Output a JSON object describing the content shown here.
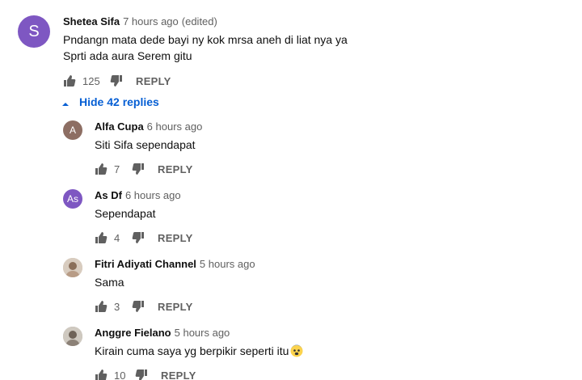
{
  "main_comment": {
    "avatar_letter": "S",
    "avatar_color": "#7e57c2",
    "author": "Shetea Sifa",
    "time": "7 hours ago",
    "edited": "(edited)",
    "text_line1": "Pndangn mata dede bayi ny kok mrsa aneh di liat nya ya",
    "text_line2": "Sprti ada aura Serem gitu",
    "likes": "125",
    "reply_label": "REPLY"
  },
  "hide_replies": {
    "label": "Hide 42 replies",
    "icon": "caret-up-icon"
  },
  "replies": [
    {
      "avatar_letter": "A",
      "avatar_color": "#8d6e63",
      "author": "Alfa Cupa",
      "time": "6 hours ago",
      "text": "Siti Sifa sependapat",
      "likes": "7",
      "reply_label": "REPLY"
    },
    {
      "avatar_letter": "As",
      "avatar_color": "#7e57c2",
      "author": "As Df",
      "time": "6 hours ago",
      "text": "Sependapat",
      "likes": "4",
      "reply_label": "REPLY"
    },
    {
      "avatar_letter": "",
      "avatar_color": "#c9b8a6",
      "author": "Fitri Adiyati Channel",
      "time": "5 hours ago",
      "text": "Sama",
      "likes": "3",
      "reply_label": "REPLY"
    },
    {
      "avatar_letter": "",
      "avatar_color": "#a8a29a",
      "author": "Anggre Fielano",
      "time": "5 hours ago",
      "text": "Kirain cuma saya yg berpikir seperti itu",
      "likes": "10",
      "reply_label": "REPLY"
    }
  ],
  "colors": {
    "link_blue": "#065fd4",
    "secondary_text": "#606060"
  }
}
